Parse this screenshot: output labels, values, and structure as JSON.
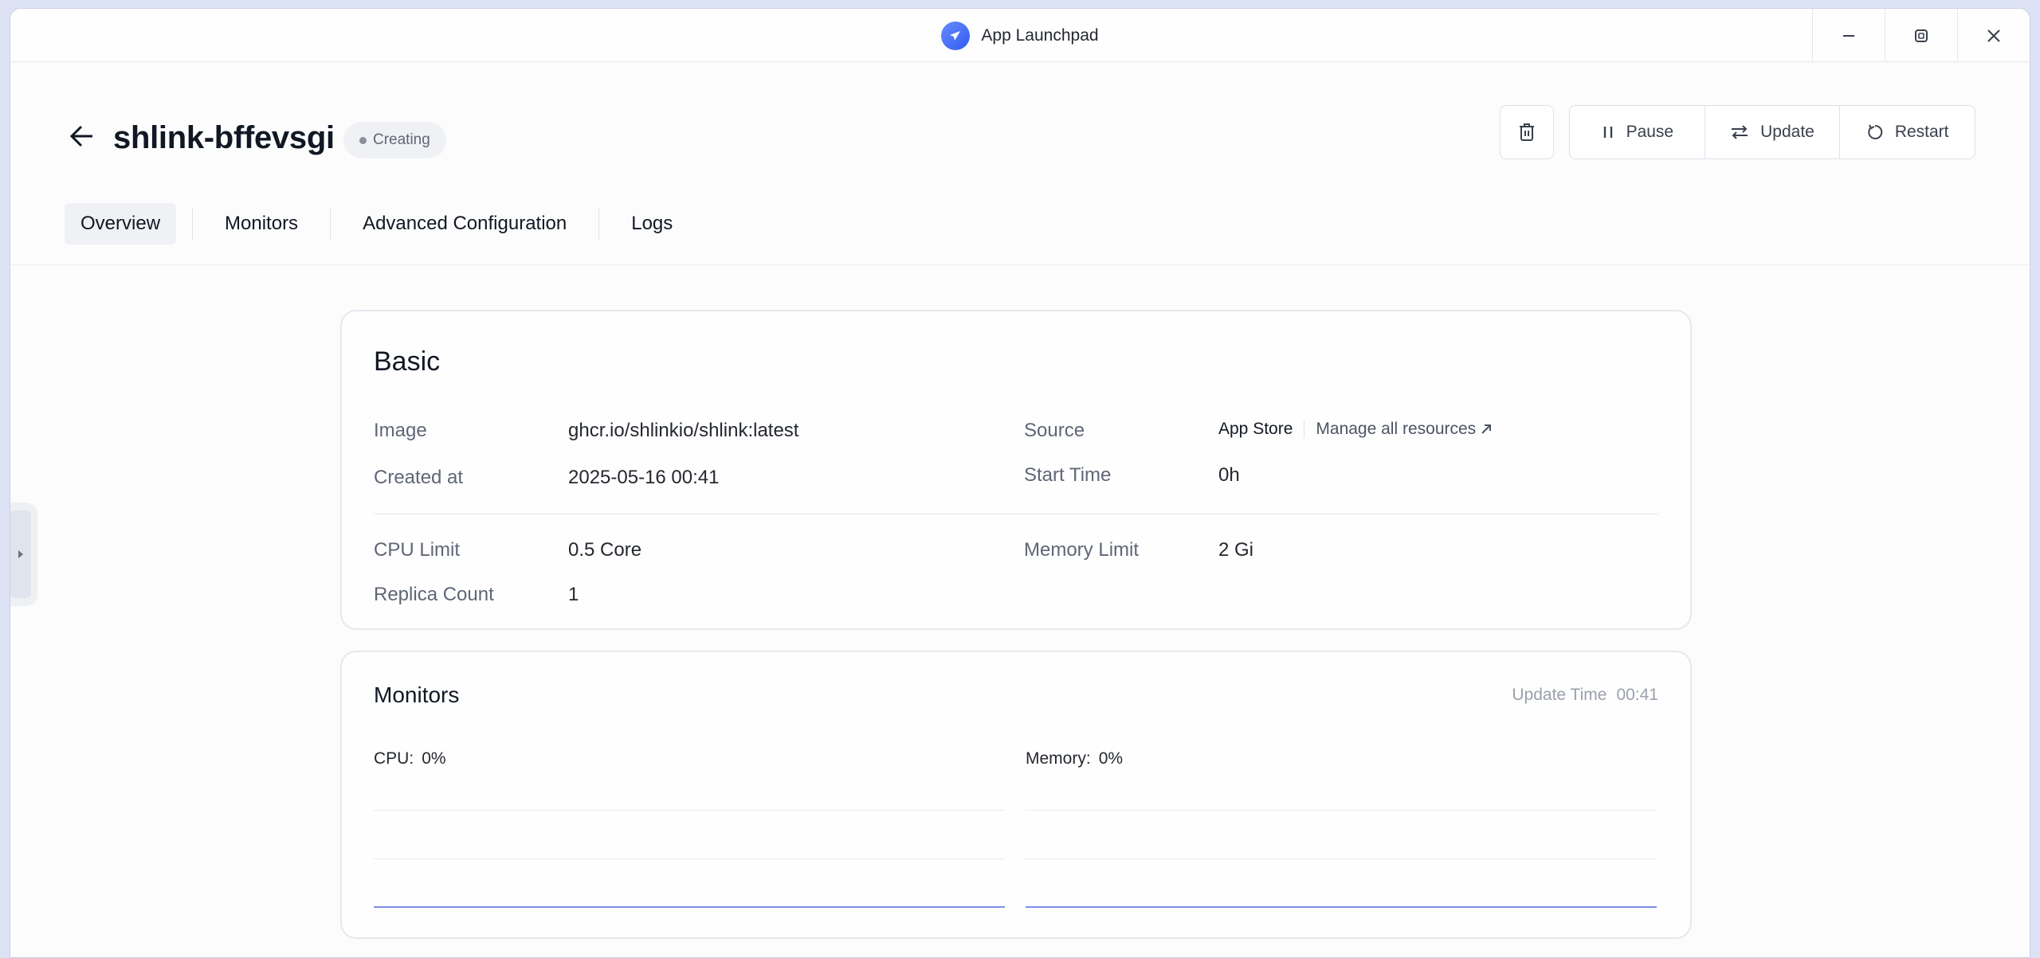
{
  "window": {
    "title": "App Launchpad"
  },
  "header": {
    "app_name": "shlink-bffevsgi",
    "status": "Creating",
    "actions": {
      "pause": "Pause",
      "update": "Update",
      "restart": "Restart"
    }
  },
  "tabs": [
    "Overview",
    "Monitors",
    "Advanced Configuration",
    "Logs"
  ],
  "basic": {
    "title": "Basic",
    "image_label": "Image",
    "image_value": "ghcr.io/shlinkio/shlink:latest",
    "created_label": "Created at",
    "created_value": "2025-05-16 00:41",
    "source_label": "Source",
    "source_value": "App Store",
    "manage_link": "Manage all resources",
    "start_label": "Start Time",
    "start_value": "0h",
    "cpu_label": "CPU Limit",
    "cpu_value": "0.5 Core",
    "memory_label": "Memory Limit",
    "memory_value": "2 Gi",
    "replica_label": "Replica Count",
    "replica_value": "1"
  },
  "monitors": {
    "title": "Monitors",
    "update_time_label": "Update Time",
    "update_time_value": "00:41",
    "cpu_label": "CPU:",
    "cpu_value": "0%",
    "memory_label": "Memory:",
    "memory_value": "0%"
  },
  "colors": {
    "accent": "#7d8ce8",
    "logo": "#3d66f5"
  },
  "icons": [
    "rocket-icon",
    "minimize-icon",
    "restore-icon",
    "close-icon",
    "arrow-left-icon",
    "trash-icon",
    "pause-icon",
    "swap-icon",
    "restart-icon",
    "external-link-icon",
    "caret-right-icon"
  ]
}
